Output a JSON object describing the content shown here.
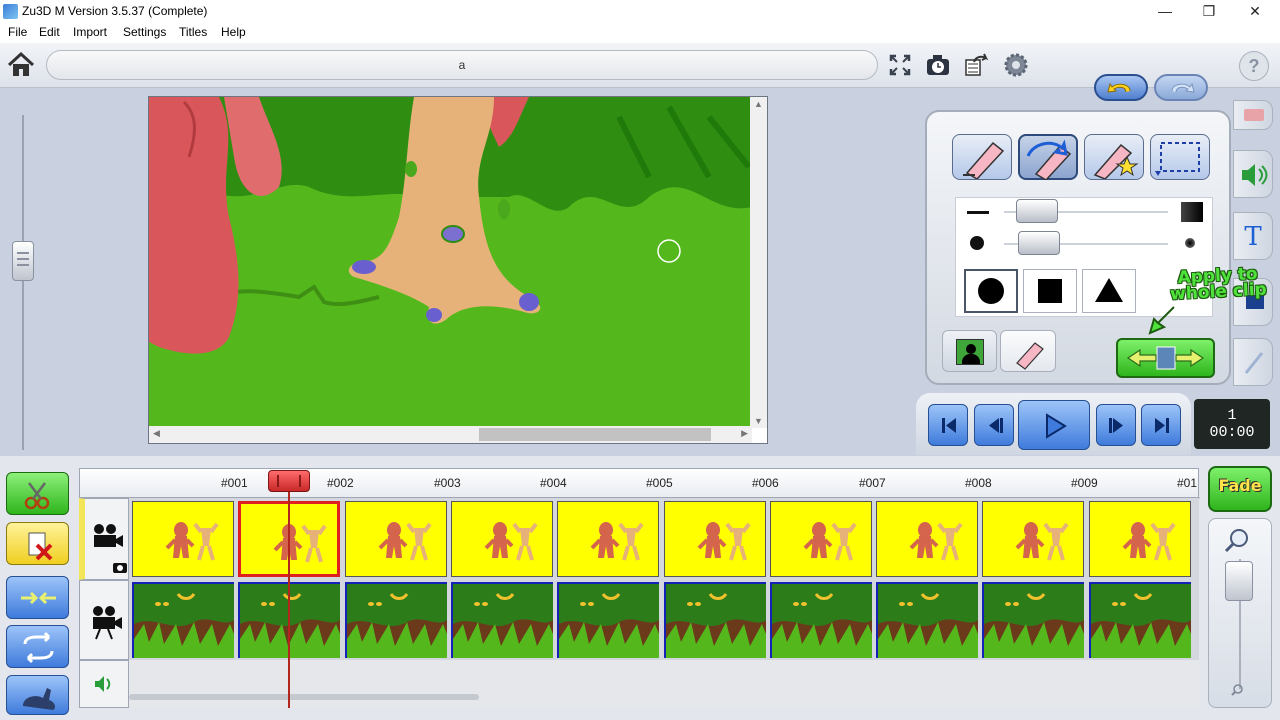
{
  "window": {
    "title": "Zu3D M Version 3.5.37 (Complete)",
    "controls": [
      "—",
      "❐",
      "✕"
    ]
  },
  "menu": [
    "File",
    "Edit",
    "Import",
    "Settings",
    "Titles",
    "Help"
  ],
  "toolbar": {
    "project_name": "a",
    "icons": [
      "fullscreen-icon",
      "camera-timer-icon",
      "export-icon",
      "settings-gear-icon"
    ],
    "help_label": "?"
  },
  "edit_panel": {
    "tools": [
      "eraser-tool",
      "restore-tool",
      "star-eraser-tool",
      "selection-tool"
    ],
    "active_tool": 1,
    "shapes": [
      "circle",
      "square",
      "triangle"
    ],
    "active_shape": 0,
    "apply_text": "Apply to whole clip",
    "mode_tabs": [
      "silhouette-mask-icon",
      "eraser-mode-icon"
    ]
  },
  "side_tabs": [
    "camera-icon",
    "sound-icon",
    "text-icon",
    "layer-icon",
    "pen-icon"
  ],
  "transport": {
    "frame_number": "1",
    "time": "00:00"
  },
  "timeline": {
    "ticks": [
      "#001",
      "#002",
      "#003",
      "#004",
      "#005",
      "#006",
      "#007",
      "#008",
      "#009",
      "#01"
    ],
    "fade_label": "Fade",
    "selected_frame": 2,
    "frame_count": 10
  },
  "colors": {
    "accent_blue": "#3f7bdc",
    "accent_green": "#2fb51c",
    "frame_yellow": "#ffff00",
    "selection_red": "#e02020",
    "background_green": "#54b81c"
  }
}
